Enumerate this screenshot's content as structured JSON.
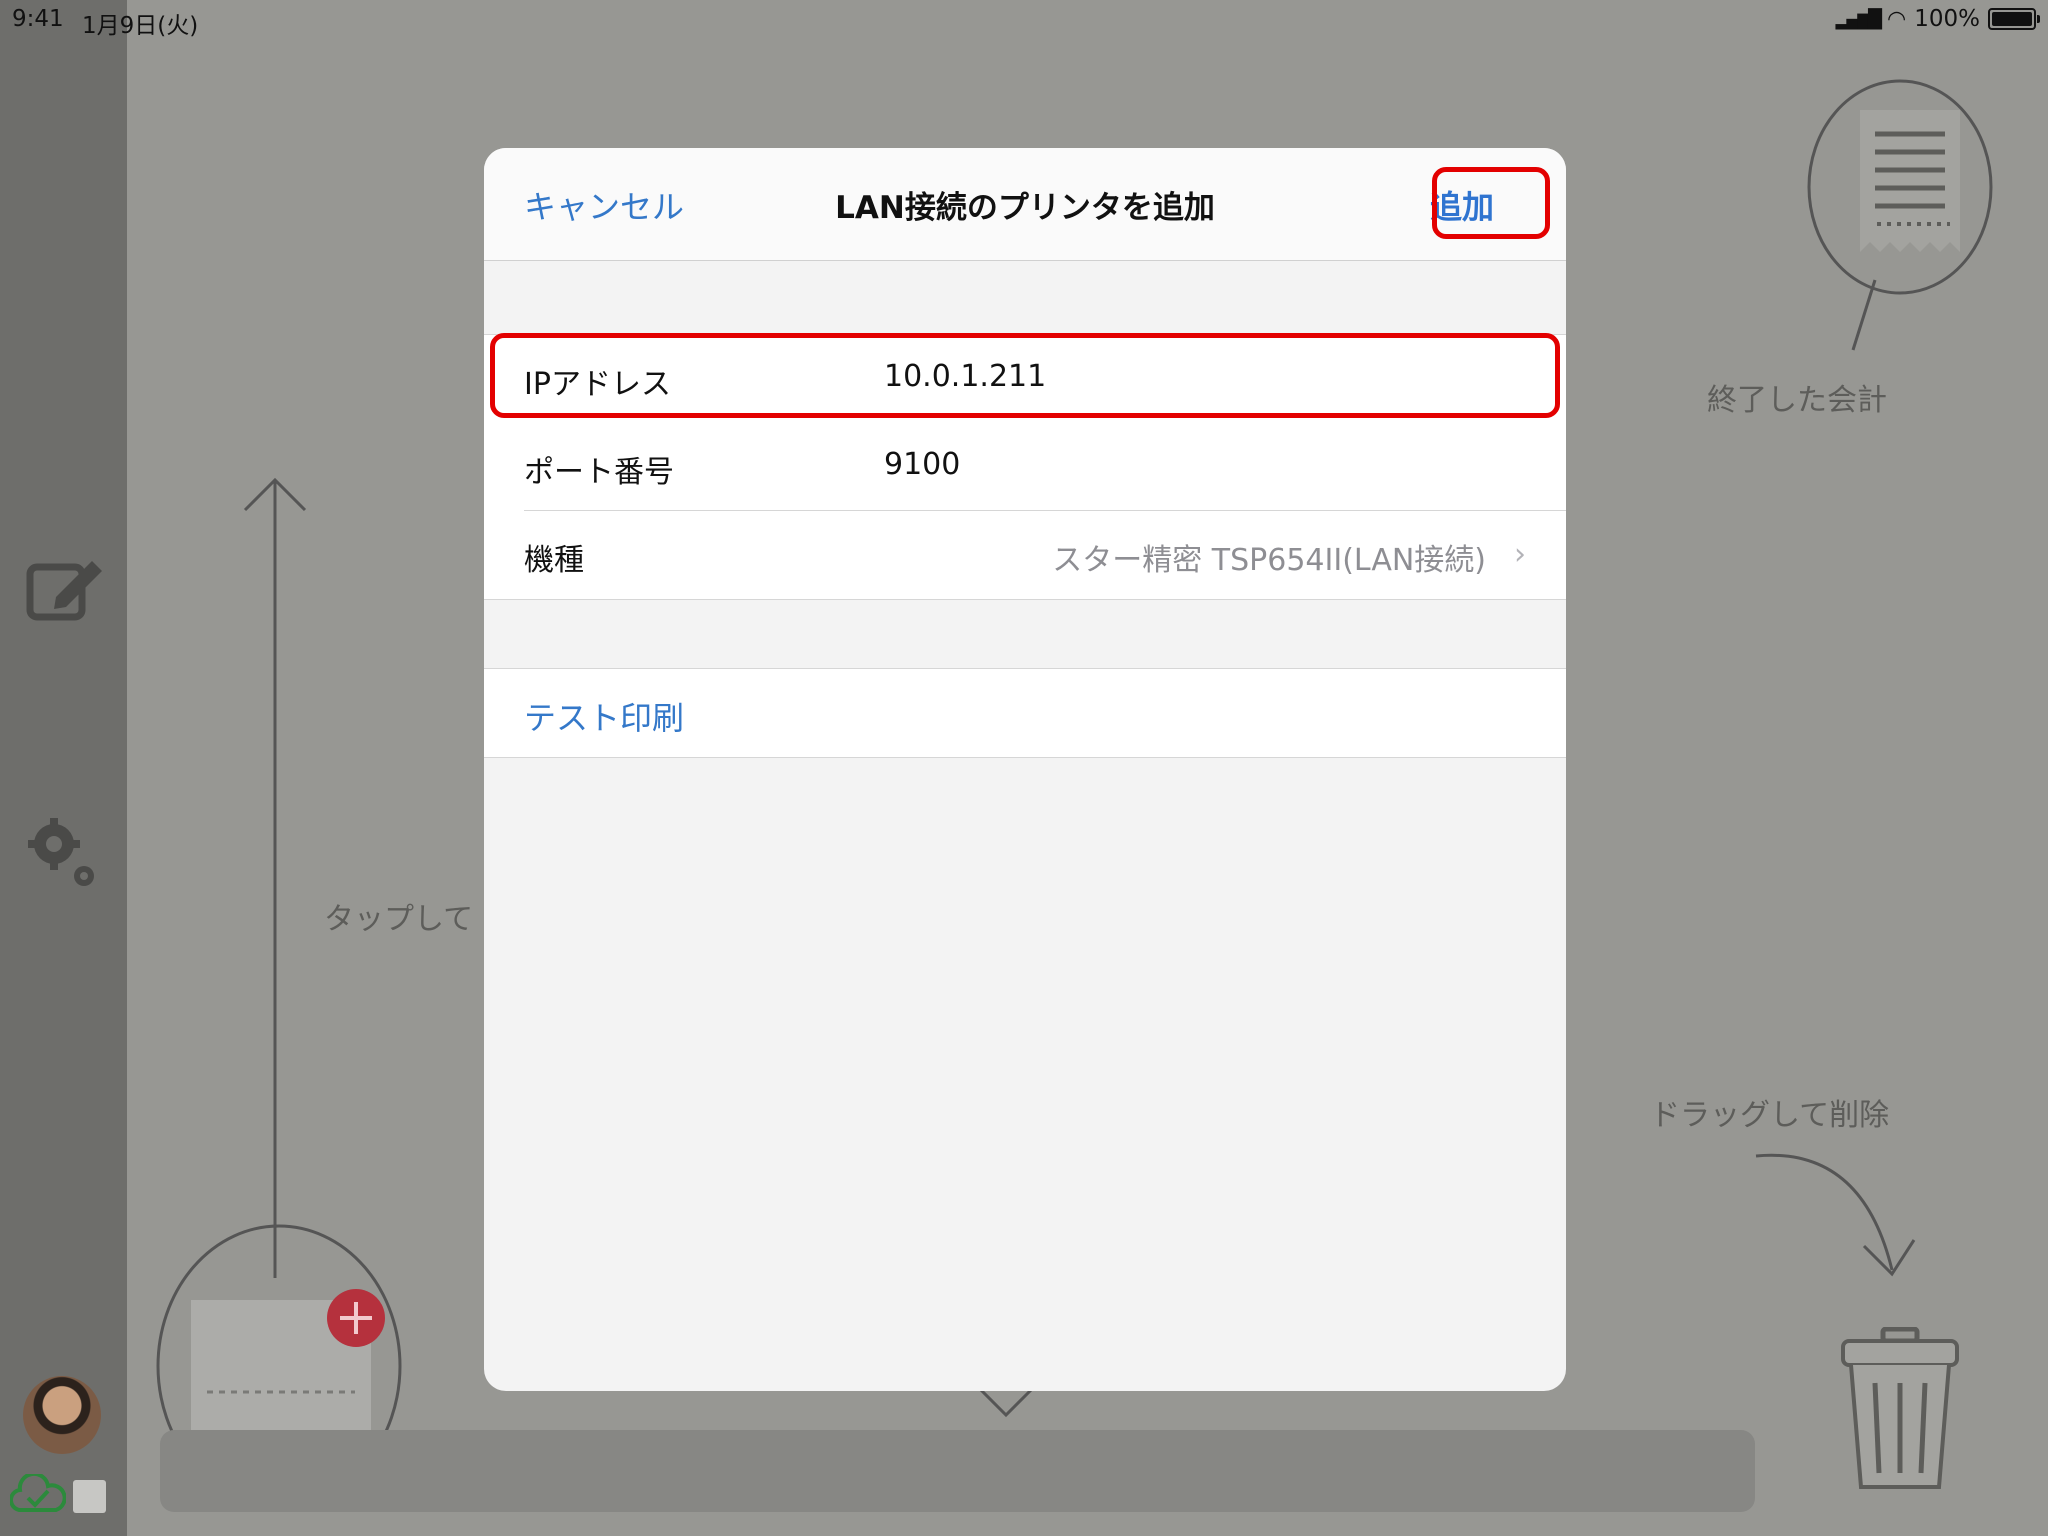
{
  "status_bar": {
    "time": "9:41",
    "date": "1月9日(火)",
    "battery": "100%"
  },
  "background": {
    "finished_label": "終了した会計",
    "tap_label": "タップして",
    "drag_delete_label": "ドラッグして削除"
  },
  "dialog": {
    "cancel": "キャンセル",
    "title": "LAN接続のプリンタを追加",
    "add": "追加",
    "rows": [
      {
        "label": "IPアドレス",
        "value": "10.0.1.211"
      },
      {
        "label": "ポート番号",
        "value": "9100"
      },
      {
        "label": "機種",
        "value": "スター精密 TSP654II(LAN接続)"
      }
    ],
    "test_print": "テスト印刷"
  },
  "colors": {
    "accent": "#3478c9",
    "highlight": "#e30000",
    "badge": "#b5313d"
  }
}
